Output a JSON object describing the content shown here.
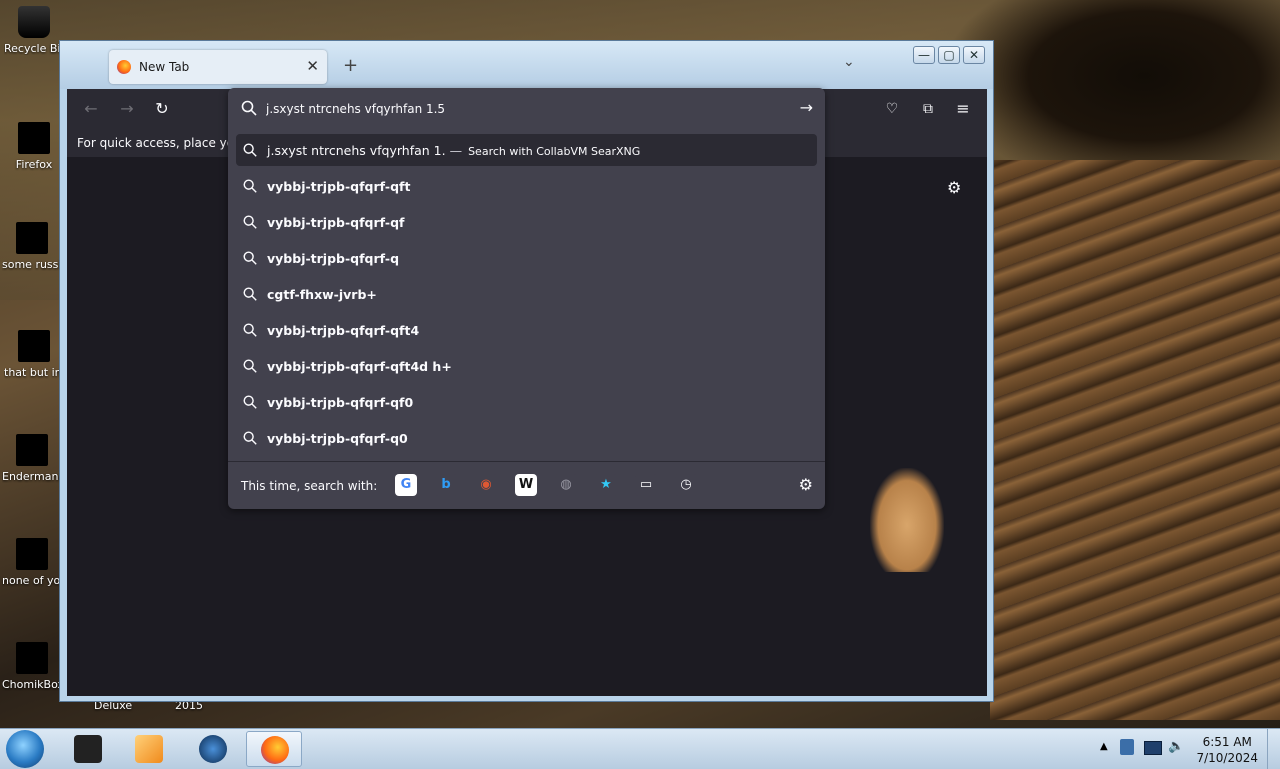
{
  "desktop": {
    "icons": [
      {
        "label": "Recycle Bin"
      },
      {
        "label": "Firefox"
      },
      {
        "label": "some russi ran a rat"
      },
      {
        "label": "that but in C#"
      },
      {
        "label": "Endermane"
      },
      {
        "label": "none of you retards kno"
      },
      {
        "label": "ChomikBox"
      }
    ],
    "under_labels": [
      "Deluxe",
      "2015"
    ]
  },
  "browser": {
    "tab_title": "New Tab",
    "tab_close": "✕",
    "new_tab": "+",
    "tab_list": "⌄",
    "bookmarks_text": "For quick access, place your bookmarks here on the bookmarks toolbar.",
    "window_controls": {
      "minimize": "—",
      "maximize": "▢",
      "close": "✕"
    }
  },
  "urlbar": {
    "value": "j.sxyst ntrcnehs vfqyrhfan 1.5",
    "go": "→",
    "suggestions": [
      {
        "text": "j.sxyst ntrcnehs vfqyrhfan 1.",
        "dash": "—",
        "hint": "Search with CollabVM SearXNG",
        "selected": true
      },
      {
        "text": "vybbj-trjpb-qfqrf-qft"
      },
      {
        "text": "vybbj-trjpb-qfqrf-qf"
      },
      {
        "text": "vybbj-trjpb-qfqrf-q"
      },
      {
        "text": "cgtf-fhxw-jvrb+"
      },
      {
        "text": "vybbj-trjpb-qfqrf-qft4"
      },
      {
        "text": "vybbj-trjpb-qfqrf-qft4d h+"
      },
      {
        "text": "vybbj-trjpb-qfqrf-qf0"
      },
      {
        "text": "vybbj-trjpb-qfqrf-q0"
      }
    ],
    "oneoff_label": "This time, search with:",
    "engines": [
      {
        "name": "google-icon",
        "glyph": "G",
        "color": "#ffffff",
        "fg": "#4285f4"
      },
      {
        "name": "bing-icon",
        "glyph": "b",
        "color": "#42414d",
        "fg": "#2f9cf5"
      },
      {
        "name": "duckduckgo-icon",
        "glyph": "◉",
        "color": "#42414d",
        "fg": "#de5833"
      },
      {
        "name": "wikipedia-icon",
        "glyph": "W",
        "color": "#ffffff",
        "fg": "#111111"
      },
      {
        "name": "searxng-icon",
        "glyph": "◍",
        "color": "#42414d",
        "fg": "#9a9aa5"
      },
      {
        "name": "bookmarks-star-icon",
        "glyph": "★",
        "color": "#42414d",
        "fg": "#33c9f5"
      },
      {
        "name": "tabs-icon",
        "glyph": "▭",
        "color": "#42414d",
        "fg": "#fbfbfe"
      },
      {
        "name": "history-icon",
        "glyph": "◷",
        "color": "#42414d",
        "fg": "#fbfbfe"
      }
    ]
  },
  "taskbar": {
    "time": "6:51 AM",
    "date": "7/10/2024"
  }
}
